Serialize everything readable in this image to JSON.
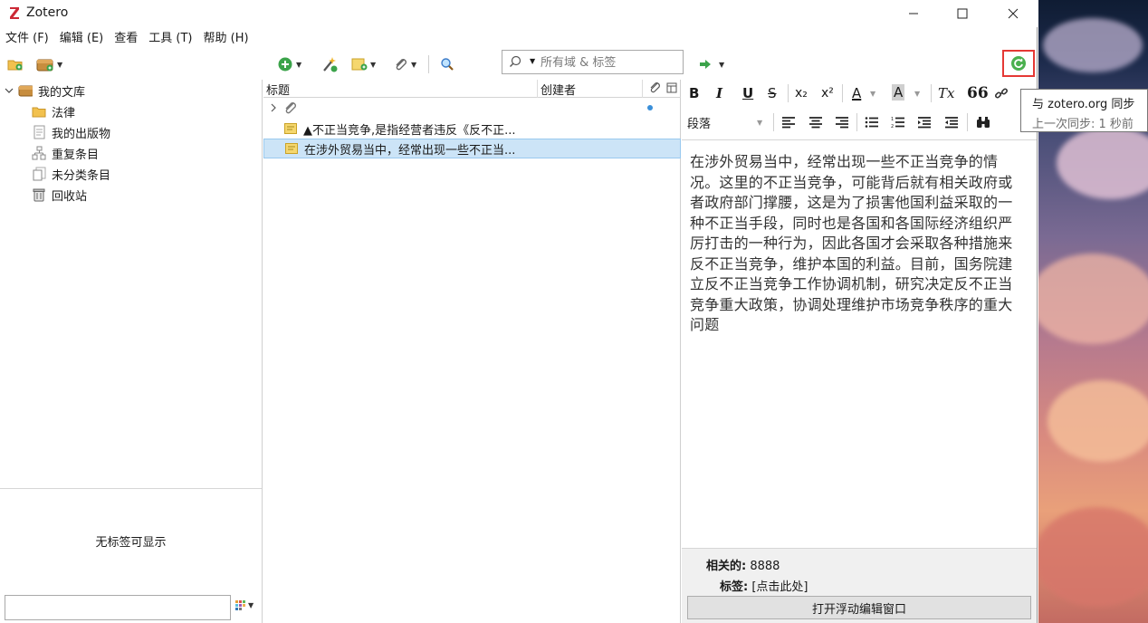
{
  "window": {
    "title": "Zotero",
    "logo_letter": "Z"
  },
  "menu": [
    "文件 (F)",
    "编辑 (E)",
    "查看",
    "工具 (T)",
    "帮助 (H)"
  ],
  "toolbar": {
    "search_placeholder": "所有域 & 标签",
    "search_value": ""
  },
  "library_tree": {
    "root": "我的文库",
    "items": [
      {
        "label": "法律",
        "icon": "folder-icon"
      },
      {
        "label": "我的出版物",
        "icon": "publications-icon"
      },
      {
        "label": "重复条目",
        "icon": "duplicates-icon"
      },
      {
        "label": "未分类条目",
        "icon": "unfiled-icon"
      },
      {
        "label": "回收站",
        "icon": "trash-icon"
      }
    ]
  },
  "tag_selector": {
    "empty_text": "无标签可显示",
    "filter_value": ""
  },
  "items_table": {
    "columns": [
      "标题",
      "创建者"
    ],
    "rows": [
      {
        "title": "▲不正当竞争,是指经营者违反《反不正...",
        "creator": "",
        "selected": false
      },
      {
        "title": "在涉外贸易当中，经常出现一些不正当...",
        "creator": "",
        "selected": true
      }
    ]
  },
  "editor": {
    "format_buttons": [
      "B",
      "I",
      "U",
      "S",
      "x₂",
      "x²",
      "A",
      "A",
      "Tx",
      "66"
    ],
    "paragraph_style": "段落",
    "note_text": "在涉外贸易当中，经常出现一些不正当竞争的情况。这里的不正当竞争，可能背后就有相关政府或者政府部门撑腰，这是为了损害他国利益采取的一种不正当手段，同时也是各国和各国际经济组织严厉打击的一种行为，因此各国才会采取各种措施来反不正当竞争，维护本国的利益。目前，国务院建立反不正当竞争工作协调机制，研究决定反不正当竞争重大政策，协调处理维护市场竞争秩序的重大问题",
    "related_label": "相关的:",
    "related_value": "8888",
    "tags_label": "标签:",
    "tags_value": "[点击此处]",
    "float_button": "打开浮动编辑窗口"
  },
  "tooltip": {
    "line1": "与 zotero.org 同步",
    "line2": "上一次同步:  1 秒前"
  },
  "colors": {
    "selection": "#cce4f7",
    "sync_highlight": "#e53935",
    "sync_icon": "#2e9b3a"
  }
}
